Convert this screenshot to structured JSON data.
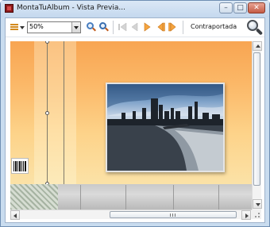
{
  "window": {
    "title": "MontaTuAlbum - Vista Previa...",
    "minimize_glyph": "–",
    "maximize_glyph": "□",
    "close_glyph": "✕"
  },
  "toolbar": {
    "zoom_value": "50%",
    "back_cover_label": "Contraportada",
    "icons": [
      "layout-menu-icon",
      "zoom-in-icon",
      "zoom-fit-icon",
      "first-page-icon",
      "previous-page-icon",
      "play-icon",
      "previous-spread-icon",
      "next-spread-icon",
      "search-zoom-icon"
    ]
  },
  "colors": {
    "accent_orange": "#f6a540",
    "page_top": "#f8a552",
    "page_bottom": "#fbe2a7",
    "titlebar": "#c4d8ee"
  }
}
